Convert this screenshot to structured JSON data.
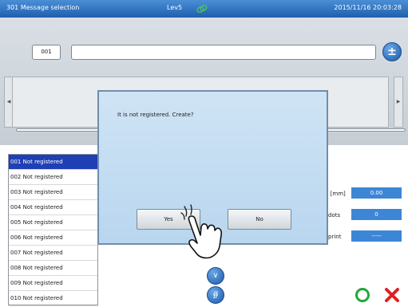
{
  "titlebar": {
    "title": "301 Message selection",
    "level": "Lev5",
    "datetime": "2015/11/16 20:03:28",
    "status_icon": "link-icon"
  },
  "editor": {
    "message_number": "001",
    "message_name": "",
    "add_button_icon": "plus-minus-icon",
    "scroll_left_icon": "triangle-left-icon",
    "scroll_right_icon": "triangle-right-icon"
  },
  "message_list": [
    "001 Not registered",
    "002 Not registered",
    "003 Not registered",
    "004 Not registered",
    "005 Not registered",
    "006 Not registered",
    "007 Not registered",
    "008 Not registered",
    "009 Not registered",
    "010 Not registered"
  ],
  "selected_index": 0,
  "properties": {
    "height_label": "h [mm]",
    "height_value": "0.00",
    "dots_label": "dots",
    "dots_value": "0",
    "print_label": "print",
    "print_value": "-----"
  },
  "nav": {
    "down_icon": "chevron-down-icon",
    "page_down_icon": "double-chevron-down-icon"
  },
  "actions": {
    "ok_icon": "circle-icon",
    "cancel_icon": "x-icon",
    "ok_color": "#1fa83a",
    "cancel_color": "#e02020"
  },
  "dialog": {
    "message": "It is not registered. Create?",
    "yes_label": "Yes",
    "no_label": "No"
  },
  "colors": {
    "accent": "#1c5aa8",
    "selection": "#1f3fb5",
    "value_box": "#3d86d6"
  }
}
